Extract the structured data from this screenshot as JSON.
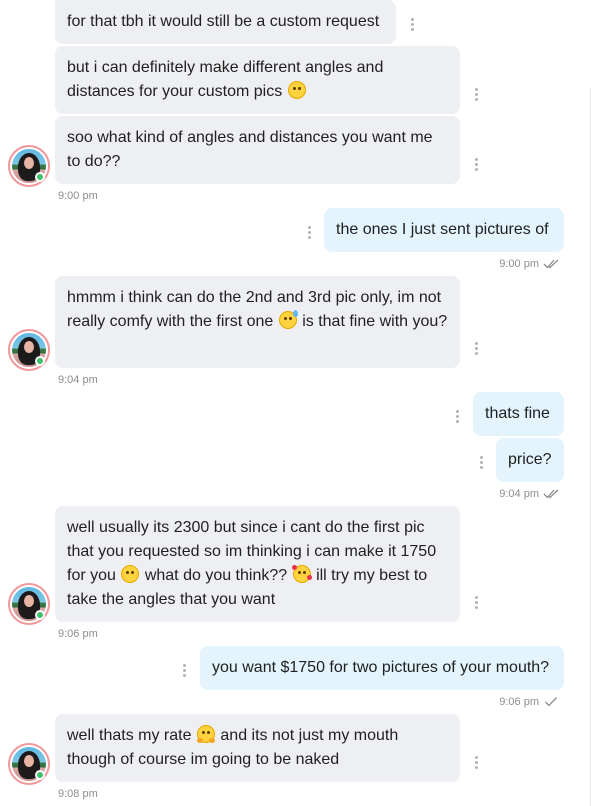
{
  "messages": [
    {
      "text": "for that tbh it would still be a custom request"
    },
    {
      "text_a": "but i can definitely make different angles and distances for your custom pics",
      "emoji": "smile-emoji"
    },
    {
      "text": "soo what kind of angles and distances you want me to do??",
      "time": "9:00 pm"
    },
    {
      "text": "the ones I just sent pictures of",
      "time": "9:00 pm",
      "status": "read"
    },
    {
      "text_a": "hmmm i think can do the 2nd and 3rd pic only, im not really comfy with the first one",
      "emoji": "sweat-smile-emoji",
      "text_b": "is that fine with you?",
      "time": "9:04 pm"
    },
    {
      "text": "thats fine"
    },
    {
      "text": "price?",
      "time": "9:04 pm",
      "status": "read"
    },
    {
      "text_a": "well usually its 2300 but since i cant do the first pic that you requested so im thinking i can make it 1750 for you",
      "emoji_a": "smile-emoji",
      "text_b": "what do you think??",
      "emoji_b": "smiling-hearts-emoji",
      "text_c": "ill try my best to take the angles that you want",
      "time": "9:06 pm"
    },
    {
      "text": "you want $1750 for two pictures of your mouth?",
      "time": "9:06 pm",
      "status": "sent"
    },
    {
      "text_a": "well thats my rate",
      "emoji": "hugging-emoji",
      "text_b": "and its not just my mouth though of course im going to be naked",
      "time": "9:08 pm"
    }
  ],
  "colors": {
    "incoming_bubble": "#eeeff2",
    "outgoing_bubble": "#e3f4fd",
    "online": "#3ec26a",
    "avatar_ring": "#f4979a"
  }
}
